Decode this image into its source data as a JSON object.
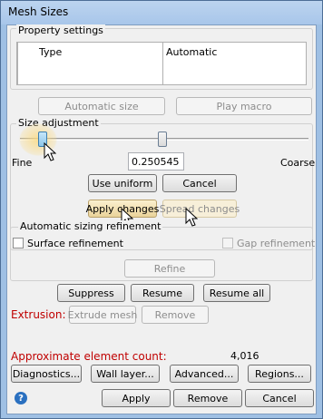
{
  "window": {
    "title": "Mesh Sizes"
  },
  "property_settings": {
    "title": "Property settings",
    "columns": [
      "Type",
      "Automatic"
    ]
  },
  "buttons": {
    "automatic_size": "Automatic size",
    "play_macro": "Play macro",
    "use_uniform": "Use uniform",
    "cancel": "Cancel",
    "apply_changes": "Apply changes",
    "spread_changes": "Spread changes",
    "refine": "Refine",
    "suppress": "Suppress",
    "resume": "Resume",
    "resume_all": "Resume all",
    "extrude_mesh": "Extrude mesh",
    "remove": "Remove",
    "diagnostics": "Diagnostics...",
    "wall_layer": "Wall layer...",
    "advanced": "Advanced...",
    "regions": "Regions...",
    "apply": "Apply",
    "remove_bottom": "Remove",
    "cancel_bottom": "Cancel"
  },
  "size_adjustment": {
    "title": "Size adjustment",
    "fine_label": "Fine",
    "coarse_label": "Coarse",
    "value": "0.250545",
    "slider_position": 0.08
  },
  "refinement": {
    "title": "Automatic sizing refinement",
    "surface_refinement": "Surface refinement",
    "gap_refinement": "Gap refinement"
  },
  "extrusion": {
    "label": "Extrusion:"
  },
  "element_count": {
    "label": "Approximate element count:",
    "value": "4,016"
  },
  "colors": {
    "accent_red": "#c00000",
    "highlight": "#ead39a"
  },
  "icons": {
    "help": "help-icon",
    "cursor": "mouse-pointer-icon"
  }
}
